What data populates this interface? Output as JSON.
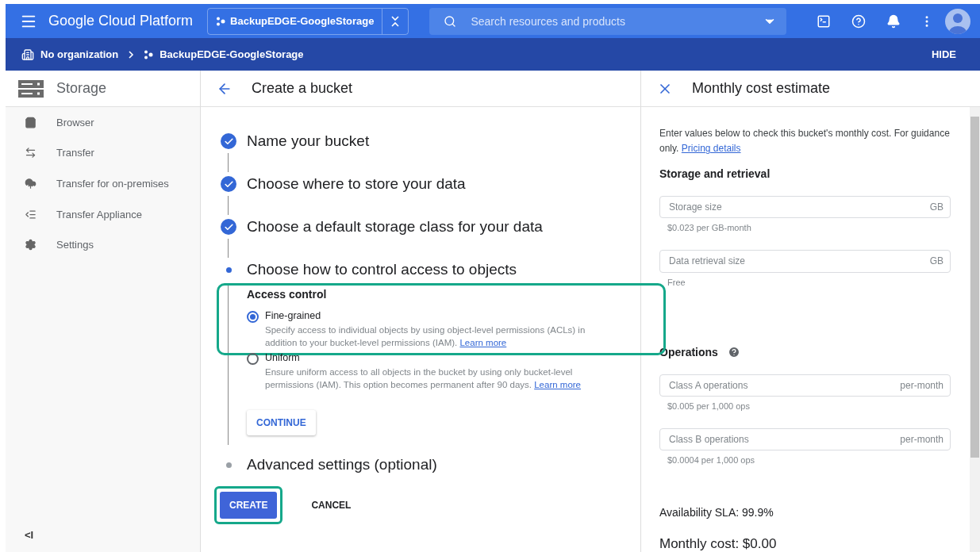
{
  "top_bar": {
    "product": "Google Cloud Platform",
    "project": "BackupEDGE-GoogleStorage",
    "search": {
      "placeholder": "Search resources and products"
    }
  },
  "breadcrumb": {
    "items": [
      "No organization",
      "BackupEDGE-GoogleStorage"
    ],
    "action": "HIDE"
  },
  "sidebar": {
    "title": "Storage",
    "items": [
      {
        "label": "Browser",
        "selected": false
      },
      {
        "label": "Transfer",
        "selected": false
      },
      {
        "label": "Transfer for on-premises",
        "selected": false
      },
      {
        "label": "Transfer Appliance",
        "selected": false
      },
      {
        "label": "Settings",
        "selected": false
      }
    ],
    "collapse": "<I"
  },
  "main": {
    "title": "Create a bucket",
    "steps": [
      {
        "label": "Name your bucket",
        "kind": "done"
      },
      {
        "label": "Choose where to store your data",
        "kind": "done"
      },
      {
        "label": "Choose a default storage class for your data",
        "kind": "done"
      },
      {
        "label": "Choose how to control access to objects",
        "kind": "current",
        "section": {
          "heading": "Access control",
          "options": [
            {
              "label": "Fine-grained",
              "description": "Specify access to individual objects by using object-level permissions (ACLs) in addition to your bucket-level permissions (IAM).",
              "link": "Learn more",
              "selected": true,
              "highlighted": true
            },
            {
              "label": "Uniform",
              "description": "Ensure uniform access to all objects in the bucket by using only bucket-level permissions (IAM). This option becomes permanent after 90 days.",
              "link": "Learn more",
              "selected": false,
              "highlighted": false
            }
          ],
          "button": "CONTINUE"
        }
      },
      {
        "label": "Advanced settings (optional)",
        "kind": "pending"
      }
    ],
    "actions": [
      {
        "label": "CREATE",
        "kind": "primary",
        "highlighted": true
      },
      {
        "label": "CANCEL",
        "kind": "text",
        "highlighted": false
      }
    ]
  },
  "cost_panel": {
    "title": "Monthly cost estimate",
    "intro": "Enter values below to check this bucket's monthly cost. For guidance only.",
    "intro_link": "Pricing details",
    "sections": [
      {
        "heading": "Storage and retrieval",
        "help": false,
        "fields": [
          {
            "placeholder": "Storage size",
            "unit": "GB",
            "hint": "$0.023 per GB-month"
          },
          {
            "placeholder": "Data retrieval size",
            "unit": "GB",
            "hint": "Free"
          }
        ]
      },
      {
        "heading": "Operations",
        "help": true,
        "fields": [
          {
            "placeholder": "Class A operations",
            "unit": "per-month",
            "hint": "$0.005 per 1,000 ops"
          },
          {
            "placeholder": "Class B operations",
            "unit": "per-month",
            "hint": "$0.0004 per 1,000 ops"
          }
        ]
      }
    ],
    "sla": "Availability SLA: 99.9%",
    "total": "Monthly cost: $0.00"
  }
}
